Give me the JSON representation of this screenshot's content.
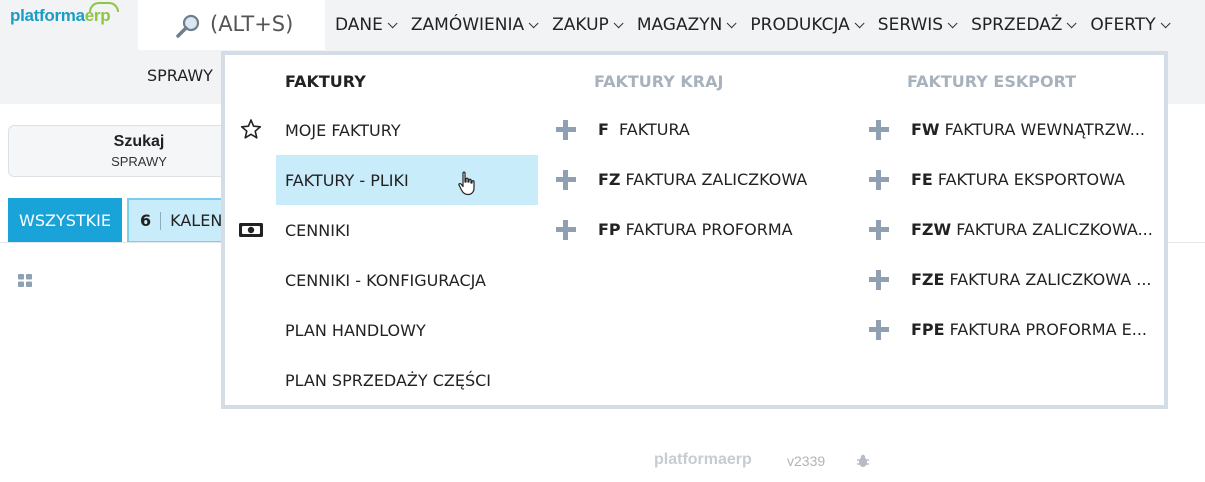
{
  "app": {
    "logo_text_a": "platforma",
    "logo_text_b": "erp",
    "search_label": "(ALT+S)"
  },
  "nav": {
    "items": [
      {
        "label": "DANE"
      },
      {
        "label": "ZAMÓWIENIA"
      },
      {
        "label": "ZAKUP"
      },
      {
        "label": "MAGAZYN"
      },
      {
        "label": "PRODUKCJA"
      },
      {
        "label": "SERWIS"
      },
      {
        "label": "SPRZEDAŻ"
      },
      {
        "label": "OFERTY"
      }
    ],
    "sub_tab": "SPRAWY"
  },
  "page": {
    "search_card_title": "Szukaj",
    "search_card_sub": "SPRAWY",
    "filter_all": "WSZYSTKIE",
    "filter_count": "6",
    "filter_kalen": "KALEN"
  },
  "dropdown": {
    "col_main_title": "FAKTURY",
    "col_kraj_title": "FAKTURY KRAJ",
    "col_eks_title": "FAKTURY ESKPORT",
    "main_items": [
      {
        "label": "MOJE FAKTURY",
        "icon": "star-icon"
      },
      {
        "label": "FAKTURY - PLIKI",
        "icon": ""
      },
      {
        "label": "CENNIKI",
        "icon": "banknote-icon"
      },
      {
        "label": "CENNIKI - KONFIGURACJA",
        "icon": ""
      },
      {
        "label": "PLAN HANDLOWY",
        "icon": ""
      },
      {
        "label": "PLAN SPRZEDAŻY CZĘŚCI",
        "icon": ""
      }
    ],
    "kraj_items": [
      {
        "code": "F",
        "label": "FAKTURA"
      },
      {
        "code": "FZ",
        "label": "FAKTURA ZALICZKOWA"
      },
      {
        "code": "FP",
        "label": "FAKTURA PROFORMA"
      }
    ],
    "eks_items": [
      {
        "code": "FW",
        "label": "FAKTURA WEWNĄTRZW..."
      },
      {
        "code": "FE",
        "label": "FAKTURA EKSPORTOWA"
      },
      {
        "code": "FZW",
        "label": "FAKTURA ZALICZKOWA..."
      },
      {
        "code": "FZE",
        "label": "FAKTURA ZALICZKOWA ..."
      },
      {
        "code": "FPE",
        "label": "FAKTURA PROFORMA E..."
      }
    ]
  },
  "footer": {
    "logo_a": "platforma",
    "logo_b": "erp",
    "version": "v2339"
  },
  "colors": {
    "accent": "#1aa3d9",
    "hover": "#c9ecfa",
    "logo_blue": "#1a9dc5",
    "logo_green": "#8dc63f"
  }
}
